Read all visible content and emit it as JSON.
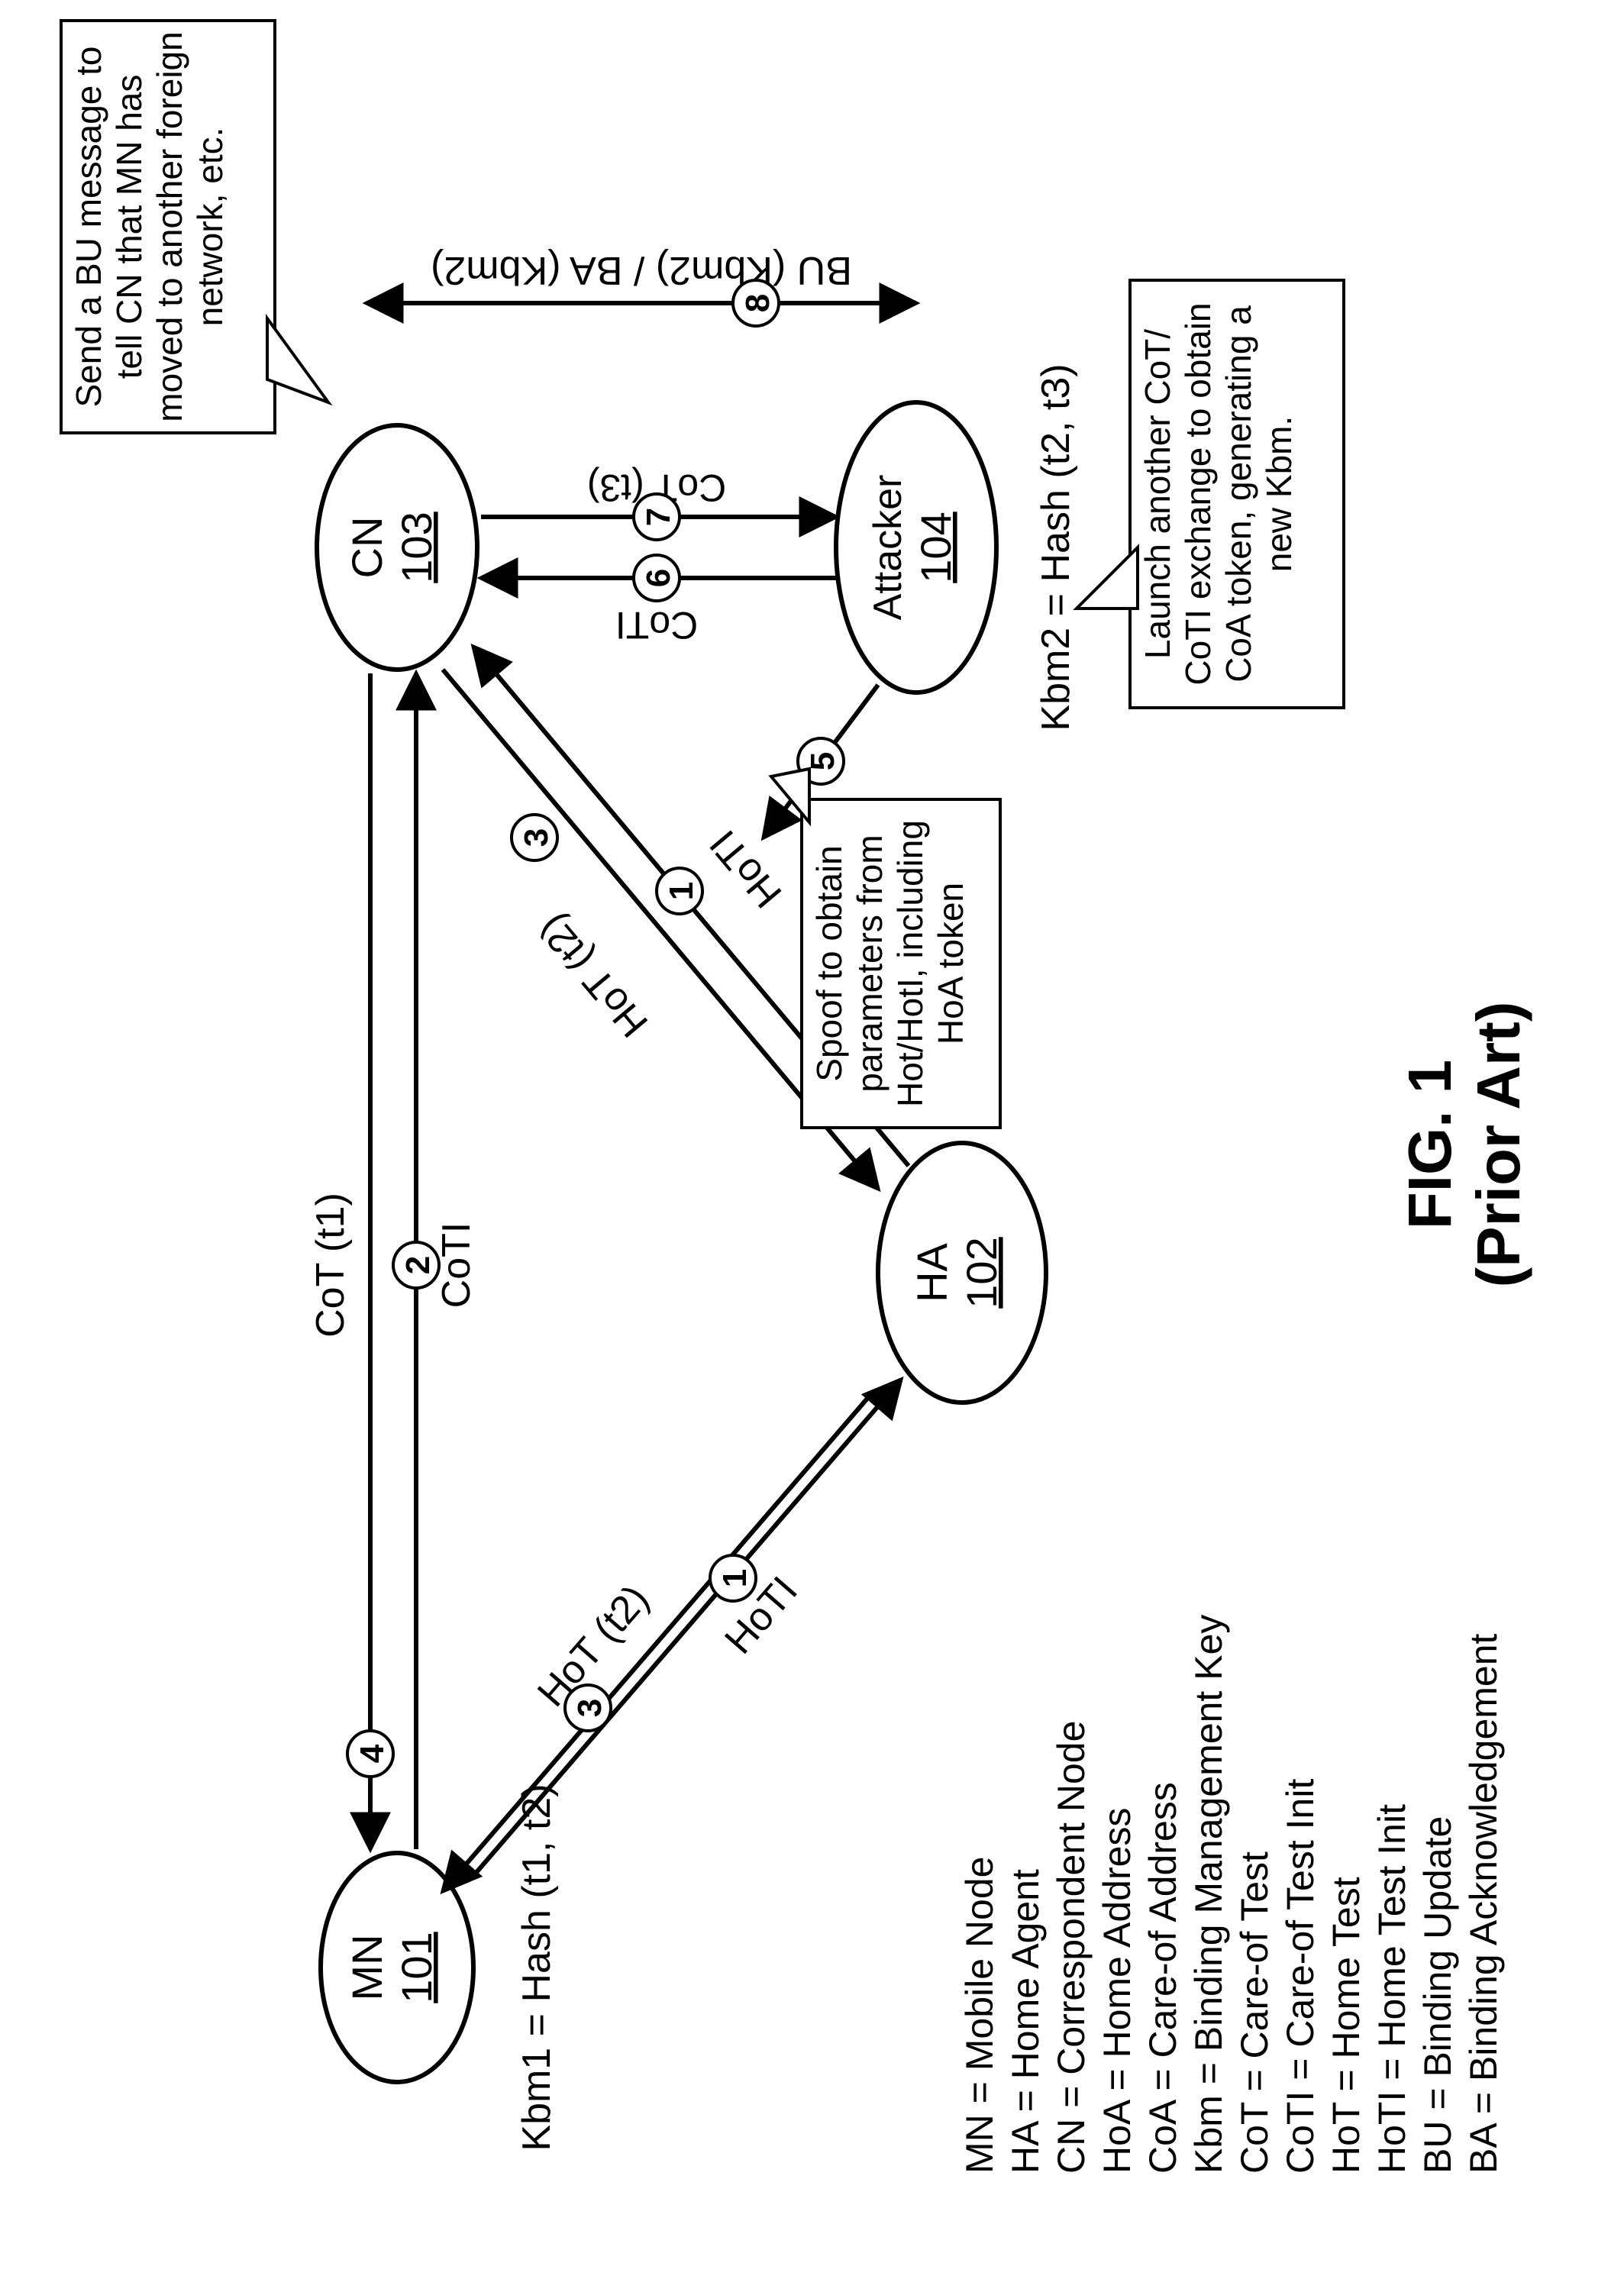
{
  "figure": {
    "title": "FIG. 1",
    "subtitle": "(Prior Art)"
  },
  "nodes": {
    "mn": {
      "label": "MN",
      "id": "101"
    },
    "ha": {
      "label": "HA",
      "id": "102"
    },
    "cn": {
      "label": "CN",
      "id": "103"
    },
    "attacker": {
      "label": "Attacker",
      "id": "104"
    }
  },
  "edge_labels": {
    "mn_ha_hoti": "HoTI",
    "mn_ha_hot": "HoT (t2)",
    "mn_cn_coti": "CoTI",
    "mn_cn_cot": "CoT (t1)",
    "ha_cn_hoti": "HoTI",
    "ha_cn_hot": "HoT (t2)",
    "attacker_cn_coti": "CoTI",
    "attacker_cn_cot": "CoT (t3)",
    "bu_ba": "BU (Kbm2) / BA (Kbm2)"
  },
  "step_numbers": {
    "s1a": "1",
    "s1b": "1",
    "s2": "2",
    "s3a": "3",
    "s3b": "3",
    "s4": "4",
    "s5": "5",
    "s6": "6",
    "s7": "7",
    "s8": "8"
  },
  "equations": {
    "kbm1": "Kbm1 = Hash (t1, t2)",
    "kbm2": "Kbm2 = Hash (t2, t3)"
  },
  "callouts": {
    "spoof": "Spoof to obtain parameters from Hot/HotI, including HoA token",
    "launch": "Launch another CoT/ CoTI exchange to obtain CoA token, generating a new Kbm.",
    "bu_msg": "Send a BU message to tell CN that MN has moved to another foreign network, etc."
  },
  "legend": [
    "MN = Mobile Node",
    "HA = Home Agent",
    "CN = Correspondent Node",
    "HoA = Home Address",
    "CoA = Care-of Address",
    "Kbm = Binding Management Key",
    "CoT = Care-of Test",
    "CoTI = Care-of Test Init",
    "HoT = Home Test",
    "HoTI = Home Test Init",
    "BU = Binding Update",
    "BA = Binding Acknowledgement"
  ]
}
